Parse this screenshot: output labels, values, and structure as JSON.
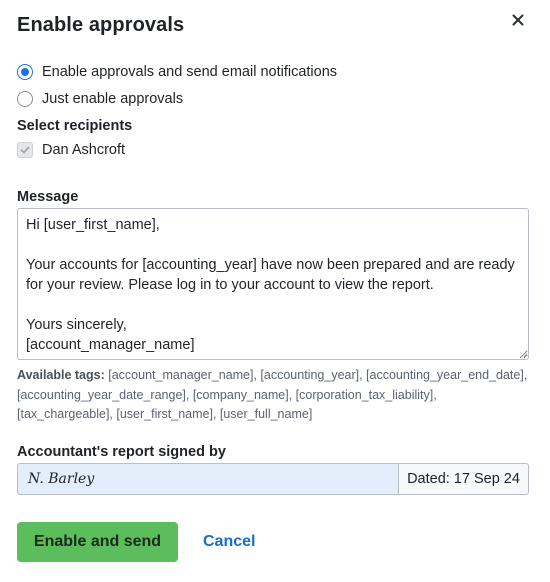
{
  "dialog": {
    "title": "Enable approvals",
    "close_icon": "close-icon"
  },
  "options": [
    {
      "label": "Enable approvals and send email notifications",
      "selected": true
    },
    {
      "label": "Just enable approvals",
      "selected": false
    }
  ],
  "recipients": {
    "label": "Select recipients",
    "items": [
      {
        "name": "Dan Ashcroft",
        "checked": true,
        "disabled": true
      }
    ]
  },
  "message": {
    "label": "Message",
    "value": "Hi [user_first_name],\n\nYour accounts for [accounting_year] have now been prepared and are ready for your review. Please log in to your account to view the report.\n\nYours sincerely,\n[account_manager_name]"
  },
  "tags": {
    "label": "Available tags:",
    "list": "[account_manager_name], [accounting_year], [accounting_year_end_date], [accounting_year_date_range], [company_name], [corporation_tax_liability], [tax_chargeable], [user_first_name], [user_full_name]"
  },
  "signed": {
    "label": "Accountant's report signed by",
    "signature": "N. Barley",
    "dated": "Dated: 17 Sep 24"
  },
  "actions": {
    "primary_label": "Enable and send",
    "cancel_label": "Cancel"
  },
  "colors": {
    "accent": "#1a73e8",
    "primary_button": "#5cbd5c",
    "link": "#1a6dc4",
    "signature_bg": "#e3edfb"
  }
}
